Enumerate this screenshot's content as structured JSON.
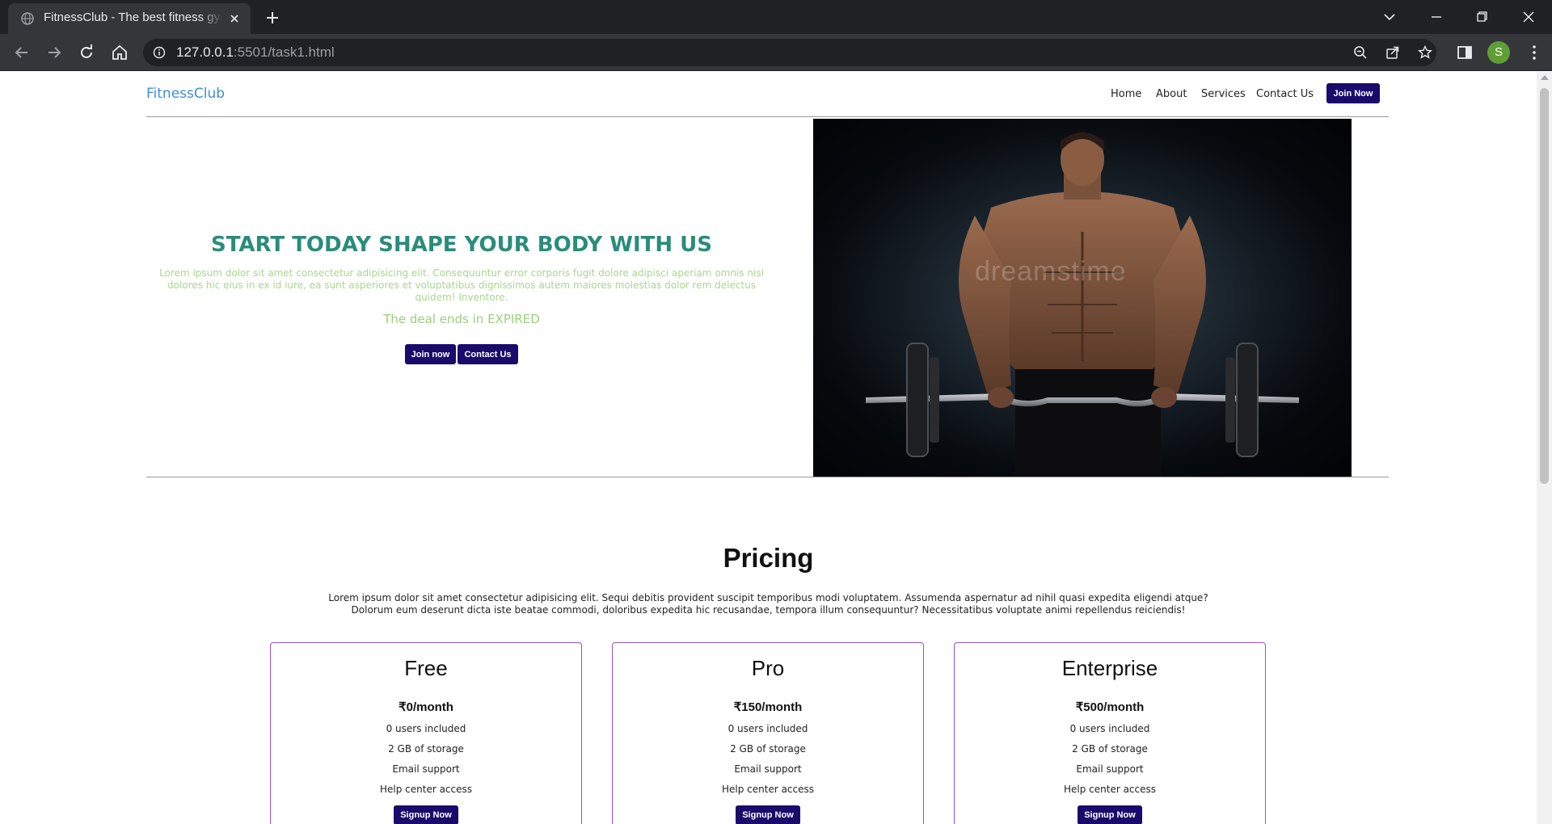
{
  "browser": {
    "tab_title": "FitnessClub - The best fitness gym",
    "url_host": "127.0.0.1",
    "url_rest": ":5501/task1.html",
    "profile_initial": "S"
  },
  "nav": {
    "brand": "FitnessClub",
    "links": [
      "Home",
      "About",
      "Services",
      "Contact Us"
    ],
    "join_label": "Join Now"
  },
  "hero": {
    "title": "START TODAY SHAPE YOUR BODY WITH US",
    "text": "Lorem ipsum dolor sit amet consectetur adipisicing elit. Consequuntur error corporis fugit dolore adipisci aperiam omnis nisi dolores hic eius in ex id iure, ea sunt asperiores et voluptatibus dignissimos autem maiores molestias dolor rem delectus quidem! Inventore.",
    "deal_text": "The deal ends in EXPIRED",
    "join_button": "Join now",
    "contact_button": "Contact Us",
    "image_watermark": "dreamstime"
  },
  "pricing": {
    "title": "Pricing",
    "text": "Lorem ipsum dolor sit amet consectetur adipisicing elit. Sequi debitis provident suscipit temporibus modi voluptatem. Assumenda aspernatur ad nihil quasi expedita eligendi atque? Dolorum eum deserunt dicta iste beatae commodi, doloribus expedita hic recusandae, tempora illum consequuntur? Necessitatibus voluptate animi repellendus reiciendis!",
    "plans": [
      {
        "name": "Free",
        "price": "₹0/month",
        "features": [
          "0 users included",
          "2 GB of storage",
          "Email support",
          "Help center access"
        ],
        "button": "Signup Now"
      },
      {
        "name": "Pro",
        "price": "₹150/month",
        "features": [
          "0 users included",
          "2 GB of storage",
          "Email support",
          "Help center access"
        ],
        "button": "Signup Now"
      },
      {
        "name": "Enterprise",
        "price": "₹500/month",
        "features": [
          "0 users included",
          "2 GB of storage",
          "Email support",
          "Help center access"
        ],
        "button": "Signup Now"
      }
    ]
  },
  "colors": {
    "brand": "#3b8ed8",
    "button_bg": "#1a0a6b",
    "hero_title": "#2a8c7a",
    "hero_text": "#a7d88d",
    "card_border": "#9b4fd8"
  }
}
